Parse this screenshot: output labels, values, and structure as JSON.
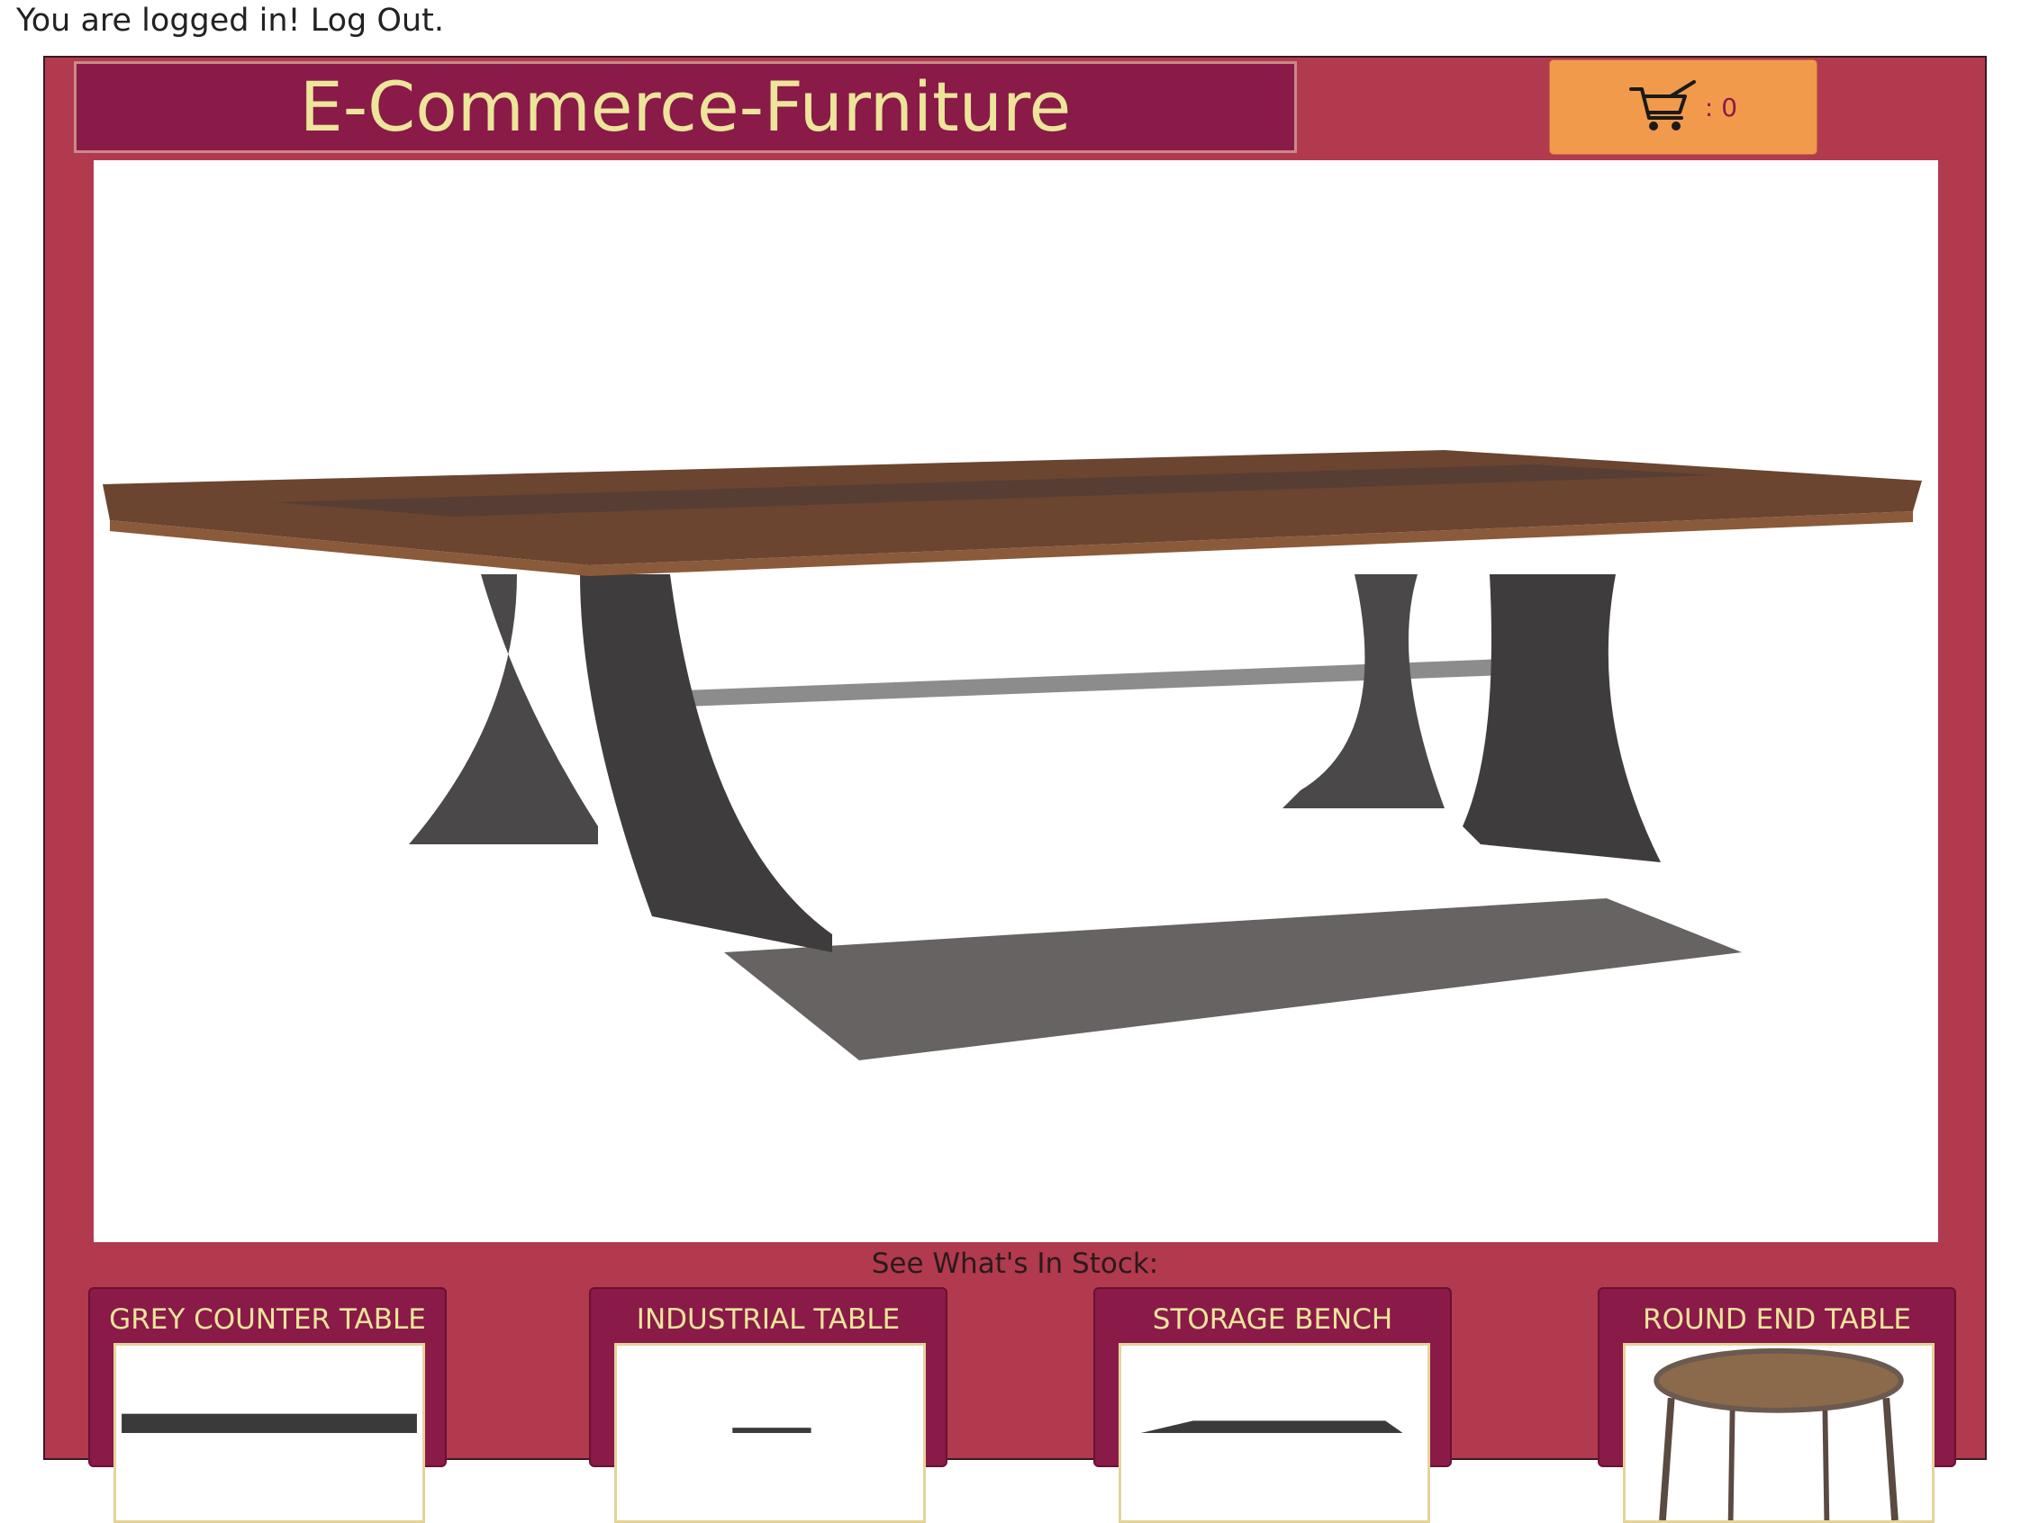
{
  "auth": {
    "message": "You are logged in!",
    "logout_label": "Log Out."
  },
  "header": {
    "title": "E-Commerce-Furniture",
    "cart": {
      "icon": "shopping-cart-icon",
      "count_label": ": 0"
    }
  },
  "hero": {
    "image": "industrial-table-photo"
  },
  "stock": {
    "heading": "See What's In Stock:",
    "products": [
      {
        "name": "GREY COUNTER TABLE",
        "image": "grey-counter-table-photo"
      },
      {
        "name": "INDUSTRIAL TABLE",
        "image": "industrial-table-photo"
      },
      {
        "name": "STORAGE BENCH",
        "image": "storage-bench-photo"
      },
      {
        "name": "ROUND END TABLE",
        "image": "round-end-table-photo"
      }
    ]
  },
  "colors": {
    "frame": "#b23a4e",
    "title_bg": "#8a1a48",
    "title_text": "#ece59a",
    "cart_bg": "#f29a4b"
  }
}
